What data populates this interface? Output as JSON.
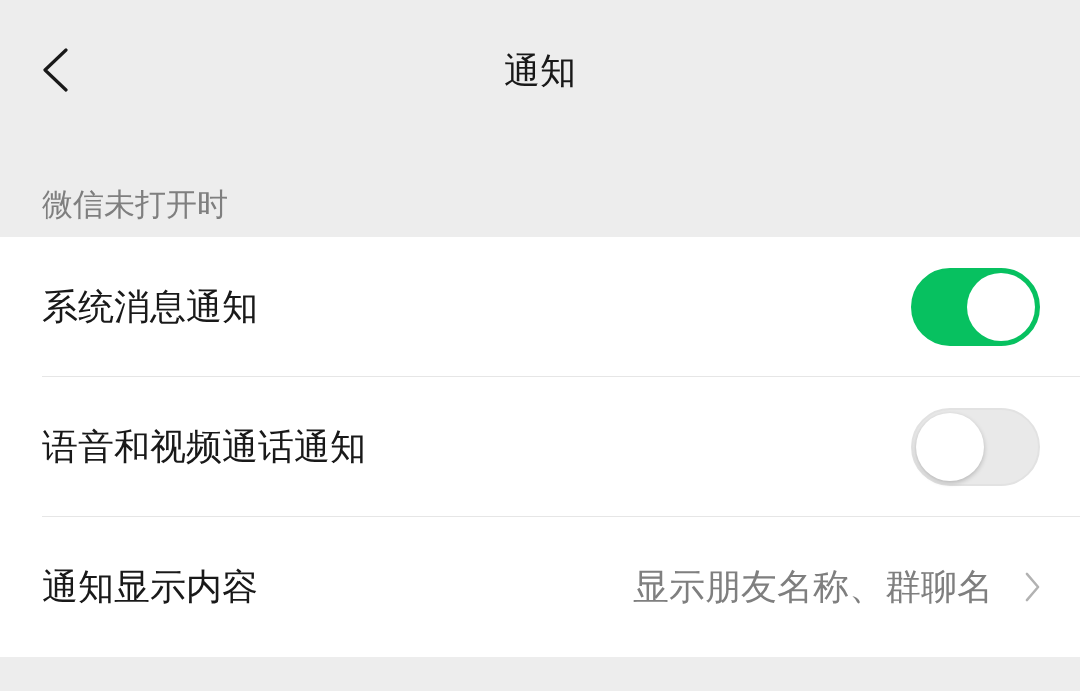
{
  "header": {
    "title": "通知"
  },
  "section": {
    "title": "微信未打开时"
  },
  "rows": [
    {
      "kind": "toggle",
      "label": "系统消息通知",
      "on": true
    },
    {
      "kind": "toggle",
      "label": "语音和视频通话通知",
      "on": false
    },
    {
      "kind": "link",
      "label": "通知显示内容",
      "value": "显示朋友名称、群聊名"
    }
  ]
}
